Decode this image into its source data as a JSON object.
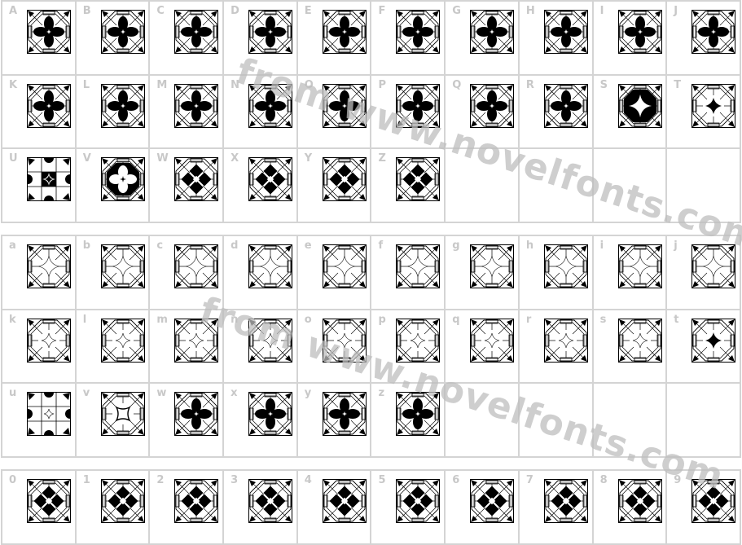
{
  "watermark": "from www.novelfonts.com",
  "label_color": "#c8c8c8",
  "grid_line_color": "#d4d4d4",
  "sections": [
    {
      "name": "uppercase",
      "cells": [
        {
          "char": "A",
          "variant": "flower",
          "fill": "full"
        },
        {
          "char": "B",
          "variant": "flower",
          "fill": "full"
        },
        {
          "char": "C",
          "variant": "flower",
          "fill": "full"
        },
        {
          "char": "D",
          "variant": "flower",
          "fill": "full"
        },
        {
          "char": "E",
          "variant": "flower",
          "fill": "full"
        },
        {
          "char": "F",
          "variant": "flower",
          "fill": "full"
        },
        {
          "char": "G",
          "variant": "flower",
          "fill": "full"
        },
        {
          "char": "H",
          "variant": "flower",
          "fill": "full"
        },
        {
          "char": "I",
          "variant": "flower",
          "fill": "full"
        },
        {
          "char": "J",
          "variant": "flower",
          "fill": "full"
        },
        {
          "char": "K",
          "variant": "flower",
          "fill": "full"
        },
        {
          "char": "L",
          "variant": "flower",
          "fill": "full"
        },
        {
          "char": "M",
          "variant": "flower",
          "fill": "full"
        },
        {
          "char": "N",
          "variant": "flower",
          "fill": "full"
        },
        {
          "char": "O",
          "variant": "flower",
          "fill": "full"
        },
        {
          "char": "P",
          "variant": "flower",
          "fill": "full"
        },
        {
          "char": "Q",
          "variant": "flower",
          "fill": "full"
        },
        {
          "char": "R",
          "variant": "flower",
          "fill": "full"
        },
        {
          "char": "S",
          "variant": "octagon-star",
          "fill": "full"
        },
        {
          "char": "T",
          "variant": "star-cross",
          "fill": "full"
        },
        {
          "char": "U",
          "variant": "grid-star",
          "fill": "full"
        },
        {
          "char": "V",
          "variant": "octagon-flower-white",
          "fill": "full"
        },
        {
          "char": "W",
          "variant": "diamond",
          "fill": "full"
        },
        {
          "char": "X",
          "variant": "diamond",
          "fill": "full"
        },
        {
          "char": "Y",
          "variant": "diamond",
          "fill": "full"
        },
        {
          "char": "Z",
          "variant": "diamond",
          "fill": "full"
        },
        {
          "char": "",
          "variant": "empty"
        },
        {
          "char": "",
          "variant": "empty"
        },
        {
          "char": "",
          "variant": "empty"
        },
        {
          "char": "",
          "variant": "empty"
        }
      ]
    },
    {
      "name": "lowercase",
      "cells": [
        {
          "char": "a",
          "variant": "star-outline"
        },
        {
          "char": "b",
          "variant": "star-outline"
        },
        {
          "char": "c",
          "variant": "star-outline"
        },
        {
          "char": "d",
          "variant": "star-outline"
        },
        {
          "char": "e",
          "variant": "star-outline"
        },
        {
          "char": "f",
          "variant": "star-outline"
        },
        {
          "char": "g",
          "variant": "star-outline"
        },
        {
          "char": "h",
          "variant": "star-outline"
        },
        {
          "char": "i",
          "variant": "star-outline"
        },
        {
          "char": "j",
          "variant": "star-outline"
        },
        {
          "char": "k",
          "variant": "small-star"
        },
        {
          "char": "l",
          "variant": "small-star"
        },
        {
          "char": "m",
          "variant": "small-star"
        },
        {
          "char": "n",
          "variant": "small-star"
        },
        {
          "char": "o",
          "variant": "small-star"
        },
        {
          "char": "p",
          "variant": "small-star"
        },
        {
          "char": "q",
          "variant": "small-star"
        },
        {
          "char": "r",
          "variant": "small-star"
        },
        {
          "char": "s",
          "variant": "small-star"
        },
        {
          "char": "t",
          "variant": "star-cross"
        },
        {
          "char": "u",
          "variant": "grid-small-star"
        },
        {
          "char": "v",
          "variant": "square-curve"
        },
        {
          "char": "w",
          "variant": "flower"
        },
        {
          "char": "x",
          "variant": "flower"
        },
        {
          "char": "y",
          "variant": "flower"
        },
        {
          "char": "z",
          "variant": "flower"
        },
        {
          "char": "",
          "variant": "empty"
        },
        {
          "char": "",
          "variant": "empty"
        },
        {
          "char": "",
          "variant": "empty"
        },
        {
          "char": "",
          "variant": "empty"
        }
      ]
    },
    {
      "name": "digits",
      "cells": [
        {
          "char": "0",
          "variant": "diamond"
        },
        {
          "char": "1",
          "variant": "diamond"
        },
        {
          "char": "2",
          "variant": "diamond"
        },
        {
          "char": "3",
          "variant": "diamond"
        },
        {
          "char": "4",
          "variant": "diamond"
        },
        {
          "char": "5",
          "variant": "diamond"
        },
        {
          "char": "6",
          "variant": "diamond"
        },
        {
          "char": "7",
          "variant": "diamond"
        },
        {
          "char": "8",
          "variant": "diamond"
        },
        {
          "char": "9",
          "variant": "diamond"
        }
      ]
    }
  ]
}
